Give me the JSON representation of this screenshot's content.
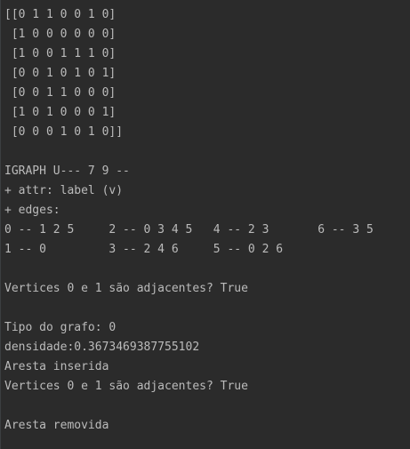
{
  "console_output": {
    "lines": [
      "[[0 1 1 0 0 1 0]",
      " [1 0 0 0 0 0 0]",
      " [1 0 0 1 1 1 0]",
      " [0 0 1 0 1 0 1]",
      " [0 0 1 1 0 0 0]",
      " [1 0 1 0 0 0 1]",
      " [0 0 0 1 0 1 0]]",
      "",
      "IGRAPH U--- 7 9 --",
      "+ attr: label (v)",
      "+ edges:",
      "0 -- 1 2 5     2 -- 0 3 4 5   4 -- 2 3       6 -- 3 5",
      "1 -- 0         3 -- 2 4 6     5 -- 0 2 6",
      "",
      "Vertices 0 e 1 são adjacentes? True",
      "",
      "Tipo do grafo: 0",
      "densidade:0.3673469387755102",
      "Aresta inserida",
      "Vertices 0 e 1 são adjacentes? True",
      "",
      "Aresta removida"
    ]
  },
  "colors": {
    "background": "#2b2b2b",
    "text": "#bbbbbb"
  }
}
